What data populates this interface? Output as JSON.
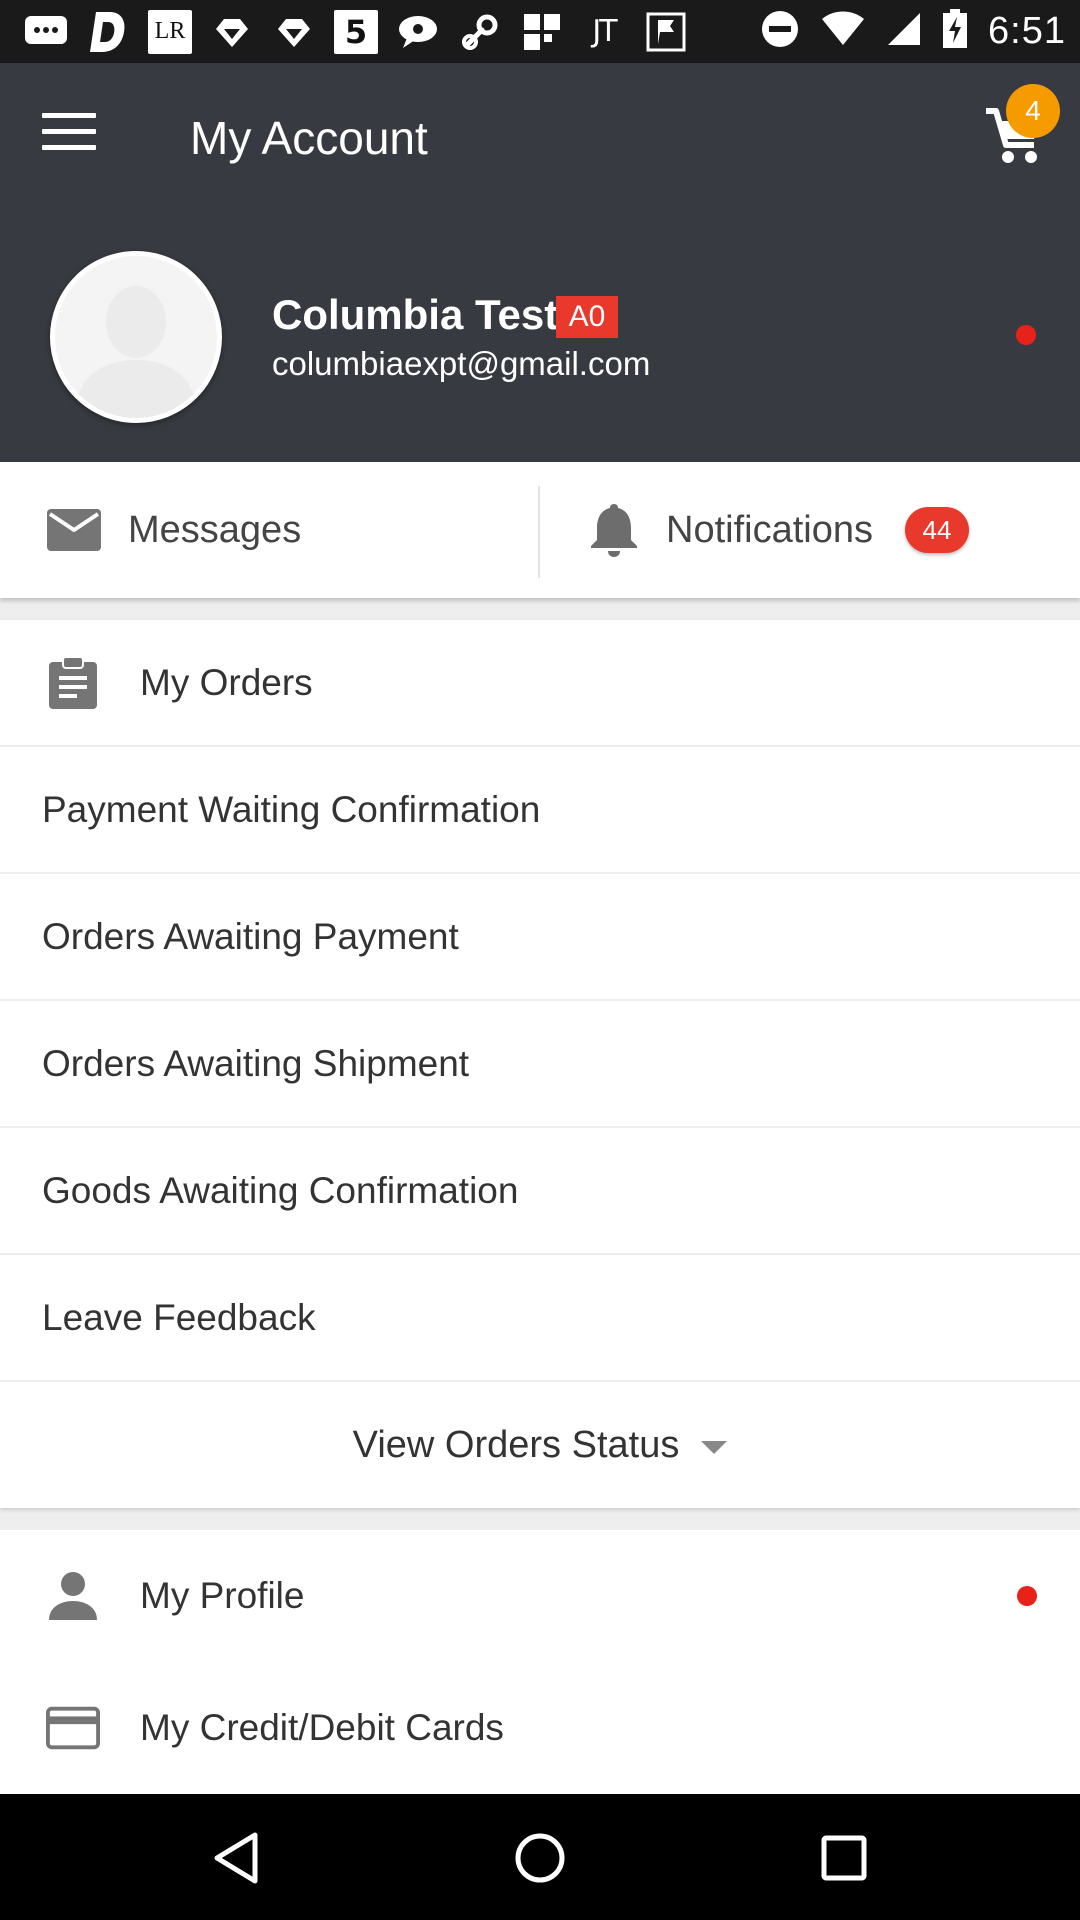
{
  "status_bar": {
    "time": "6:51",
    "notification_icons": [
      "messages-icon",
      "d-app-icon",
      "lr-app-icon",
      "reminder-icon",
      "reminder-icon",
      "s-app-icon",
      "chat-icon",
      "link-icon",
      "grid-app-icon",
      "jt-app-icon",
      "flag-app-icon"
    ],
    "lr_label": "LR",
    "five_label": "5",
    "jt_label": "JT"
  },
  "app_bar": {
    "title": "My Account",
    "cart_count": "4"
  },
  "user": {
    "name": "Columbia Test",
    "level": "A0",
    "email": "columbiaexpt@gmail.com"
  },
  "quick_links": {
    "messages_label": "Messages",
    "notifications_label": "Notifications",
    "notifications_count": "44"
  },
  "orders": {
    "title": "My Orders",
    "items": [
      {
        "label": "Payment Waiting Confirmation"
      },
      {
        "label": "Orders Awaiting Payment"
      },
      {
        "label": "Orders Awaiting Shipment"
      },
      {
        "label": "Goods Awaiting Confirmation"
      },
      {
        "label": "Leave Feedback"
      }
    ],
    "view_status_label": "View Orders Status"
  },
  "account_menu": {
    "items": [
      {
        "label": "My Profile",
        "icon": "person-icon"
      },
      {
        "label": "My Credit/Debit Cards",
        "icon": "credit-card-icon"
      }
    ]
  },
  "colors": {
    "header_bg": "#373b41",
    "badge_red": "#e8392c",
    "cart_badge": "#f59b00",
    "dot_red": "#e8221a"
  }
}
